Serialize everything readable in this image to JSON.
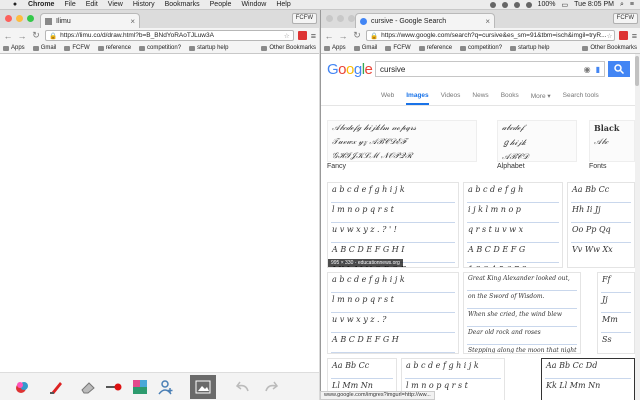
{
  "menubar": {
    "apple": "",
    "items": [
      "Chrome",
      "File",
      "Edit",
      "View",
      "History",
      "Bookmarks",
      "People",
      "Window",
      "Help"
    ],
    "battery": "100%",
    "clock": "Tue 8:05 PM"
  },
  "left": {
    "tab_title": "Ilimu",
    "profile": "FCFW",
    "url": "https://limu.co/d/draw.html?b=B_BNdYoRAoTJLuw3A",
    "bookmarks": [
      "Apps",
      "Gmail",
      "FCFW",
      "reference",
      "competition?",
      "startup help"
    ],
    "other_bookmarks": "Other Bookmarks"
  },
  "right": {
    "tab_title": "cursive - Google Search",
    "profile": "FCFW",
    "url": "https://www.google.com/search?q=cursive&es_sm=91&tbm=isch&imgil=tryR...",
    "bookmarks": [
      "Apps",
      "Gmail",
      "FCFW",
      "reference",
      "competition?",
      "startup help"
    ],
    "other_bookmarks": "Other Bookmarks",
    "logo": "Google",
    "query": "cursive",
    "search_tabs": [
      "Web",
      "Images",
      "Videos",
      "News",
      "Books",
      "More ▾",
      "Search tools"
    ],
    "active_tab": "Images",
    "related": [
      "Fancy",
      "Alphabet",
      "Fonts"
    ],
    "image_caption": "995 × 330 - educationnews.org",
    "status_url": "www.google.com/imgres?imgurl=http://ww..."
  },
  "colors": {
    "google_blue": "#4285F4",
    "google_red": "#EA4335",
    "google_yellow": "#FBBC05",
    "google_green": "#34A853",
    "extension_red": "#DD3333"
  }
}
